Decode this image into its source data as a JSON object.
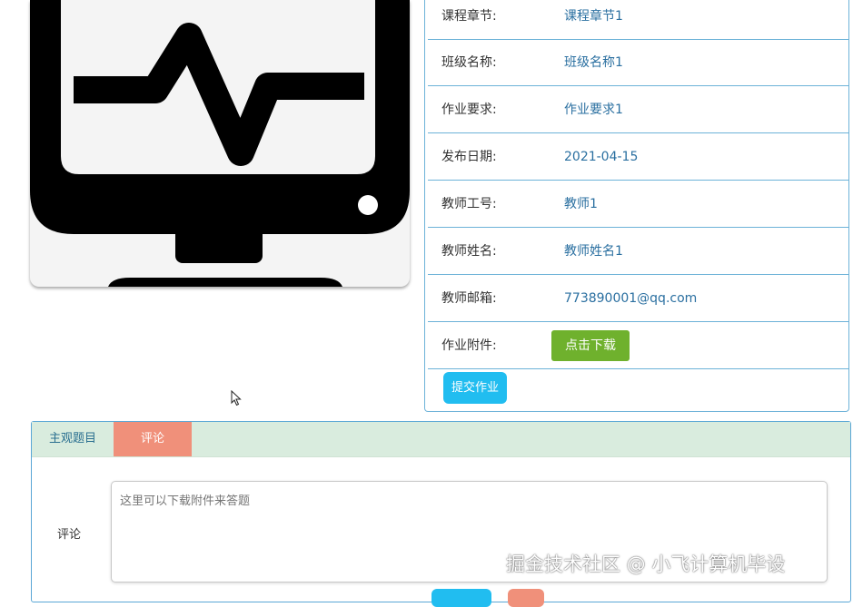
{
  "details": [
    {
      "label": "课程章节:",
      "value": "课程章节1"
    },
    {
      "label": "班级名称:",
      "value": "班级名称1"
    },
    {
      "label": "作业要求:",
      "value": "作业要求1"
    },
    {
      "label": "发布日期:",
      "value": "2021-04-15"
    },
    {
      "label": "教师工号:",
      "value": "教师1"
    },
    {
      "label": "教师姓名:",
      "value": "教师姓名1"
    },
    {
      "label": "教师邮箱:",
      "value": "773890001@qq.com"
    }
  ],
  "attachment": {
    "label": "作业附件:",
    "button": "点击下载"
  },
  "submit_button": "提交作业",
  "tabs": [
    {
      "label": "主观题目"
    },
    {
      "label": "评论"
    }
  ],
  "comment": {
    "label": "评论",
    "placeholder": "这里可以下载附件来答题"
  },
  "watermark": "掘金技术社区 @ 小飞计算机毕设",
  "colors": {
    "download_button": "#6fb12d",
    "submit_button": "#21bdf0",
    "active_tab": "#f0907a",
    "tabbar": "#d9ecde",
    "border": "#6cb2d8"
  },
  "icons": [
    "monitor-heartbeat-icon",
    "mouse-cursor-icon"
  ]
}
